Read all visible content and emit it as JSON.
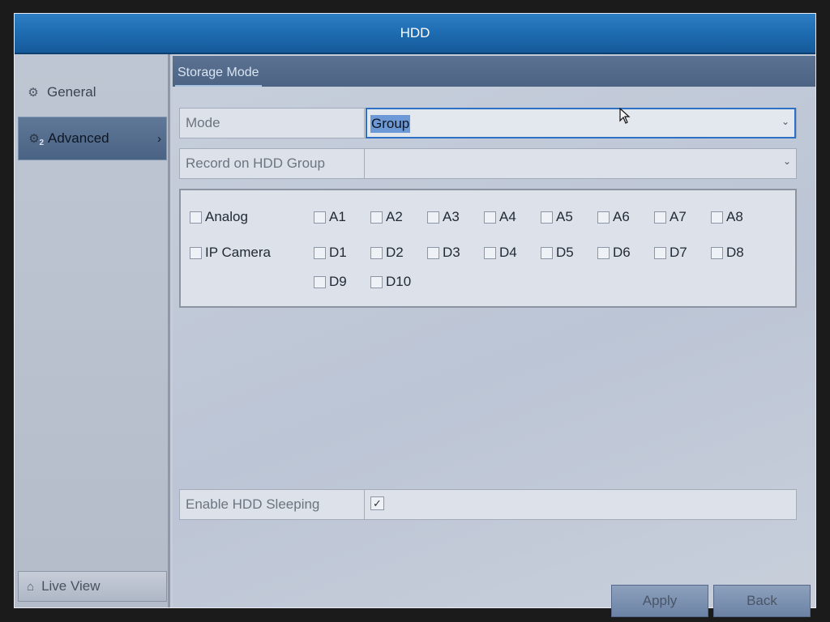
{
  "window": {
    "title": "HDD"
  },
  "sidebar": {
    "items": [
      {
        "label": "General",
        "icon": "gear-icon"
      },
      {
        "label": "Advanced",
        "icon": "gear-icon",
        "badge": "2"
      }
    ],
    "live_view": {
      "label": "Live View",
      "icon": "home-icon"
    }
  },
  "tab": {
    "label": "Storage Mode"
  },
  "mode": {
    "label": "Mode",
    "value": "Group"
  },
  "record_group": {
    "label": "Record on HDD Group",
    "value": ""
  },
  "channels": {
    "analog": {
      "label": "Analog",
      "items": [
        "A1",
        "A2",
        "A3",
        "A4",
        "A5",
        "A6",
        "A7",
        "A8"
      ]
    },
    "ip": {
      "label": "IP Camera",
      "items": [
        "D1",
        "D2",
        "D3",
        "D4",
        "D5",
        "D6",
        "D7",
        "D8",
        "D9",
        "D10"
      ]
    }
  },
  "sleeping": {
    "label": "Enable HDD Sleeping",
    "checked": true,
    "check_glyph": "✓"
  },
  "buttons": {
    "apply": "Apply",
    "back": "Back"
  },
  "colors": {
    "title_bar": "#1f6db3",
    "focus_border": "#2e71c4",
    "selection": "#6d9ad6"
  }
}
